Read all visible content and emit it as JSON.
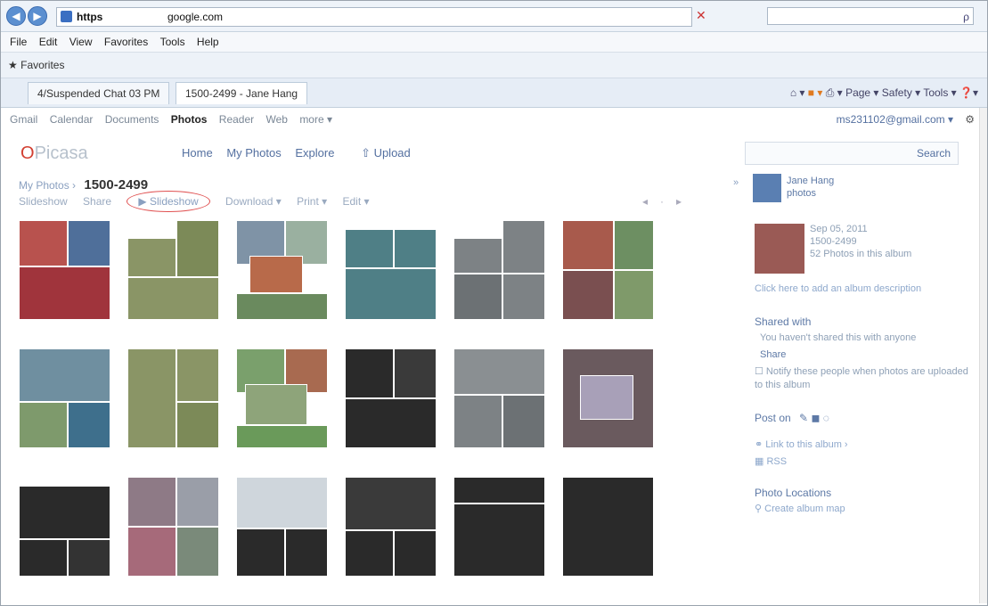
{
  "browser": {
    "url_scheme": "https",
    "url_host": "google.com",
    "search_placeholder": "ρ",
    "menu": [
      "File",
      "Edit",
      "View",
      "Favorites",
      "Tools",
      "Help"
    ],
    "favorites_label": "Favorites",
    "tabs": [
      "4/Suspended Chat 03 PM",
      "1500-2499 - Jane Hang"
    ],
    "commands": [
      "Page",
      "Safety",
      "Tools"
    ]
  },
  "gbar": {
    "items": [
      "Gmail",
      "Calendar",
      "Documents",
      "Photos",
      "Reader",
      "Web",
      "more ▾"
    ],
    "active_index": 3,
    "account": "ms231102@gmail.com ▾",
    "gear": "⚙"
  },
  "header": {
    "logo_o": "O",
    "logo_rest": "Picasa",
    "nav": [
      "Home",
      "My Photos",
      "Explore",
      "⇧ Upload"
    ],
    "search_button": "Search"
  },
  "album": {
    "crumb": "My Photos ›",
    "name": "1500-2499",
    "toolbar": [
      "Slideshow",
      "Share",
      "Download ▾",
      "Print ▾",
      "Edit ▾"
    ],
    "slideshow": "▶ Slideshow"
  },
  "sidebar": {
    "owner": "Jane Hang",
    "owner_sub": "photos",
    "date": "Sep 05, 2011",
    "album_name": "1500-2499",
    "photos_count": "52 Photos in this album",
    "desc_link": "Click here to add an album description",
    "shared_heading": "Shared with",
    "shared_text": "You haven't shared this with anyone",
    "share_button": "Share",
    "notify_text": "Notify these people when photos are uploaded to this album",
    "post_on": "Post on",
    "link_album": "Link to this album ›",
    "rss": "RSS",
    "locations_heading": "Photo Locations",
    "create_map": "Create album map"
  },
  "colors": {
    "accent": "#5470a0",
    "olive": "#8a9566",
    "teal": "#4f7f86",
    "gray": "#7d8285",
    "dark": "#2a2a2a",
    "red": "#a0343c"
  }
}
